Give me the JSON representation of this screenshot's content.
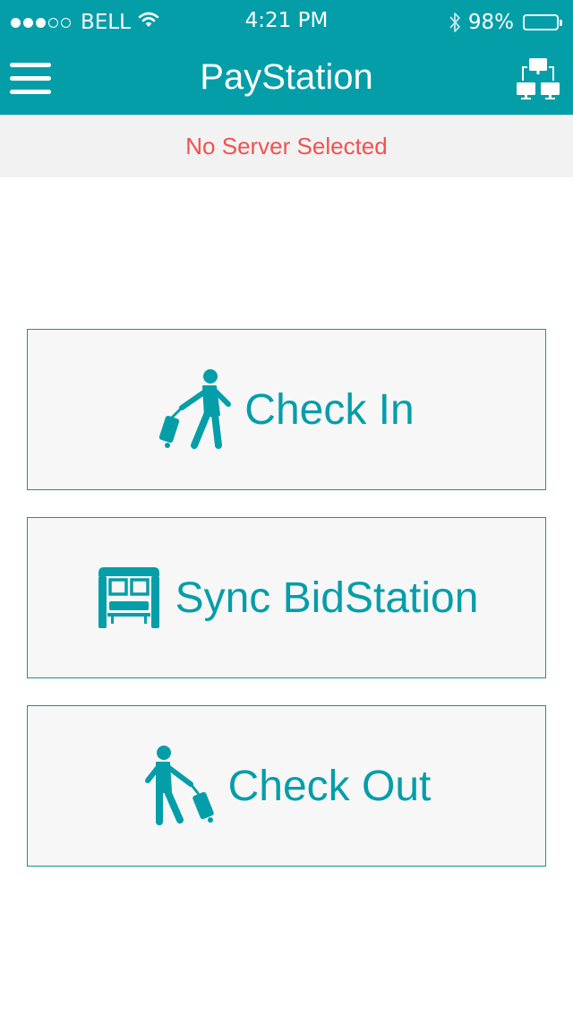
{
  "status_bar": {
    "carrier": "BELL",
    "time": "4:21 PM",
    "battery": "98%",
    "battery_level": 0.98,
    "signal_bars_filled": 3,
    "signal_bars_total": 5
  },
  "nav": {
    "title": "PayStation",
    "menu_icon": "hamburger-menu-icon",
    "right_icon": "network-servers-icon"
  },
  "server_banner": {
    "text": "No Server Selected"
  },
  "actions": [
    {
      "label": "Check In",
      "icon": "person-pulling-luggage-icon"
    },
    {
      "label": "Sync BidStation",
      "icon": "kiosk-station-icon"
    },
    {
      "label": "Check Out",
      "icon": "person-leaving-luggage-icon"
    }
  ],
  "colors": {
    "primary": "#049ea9",
    "banner_text": "#f0524f",
    "banner_bg": "#f2f2f2",
    "button_bg": "#f8f7f8"
  }
}
